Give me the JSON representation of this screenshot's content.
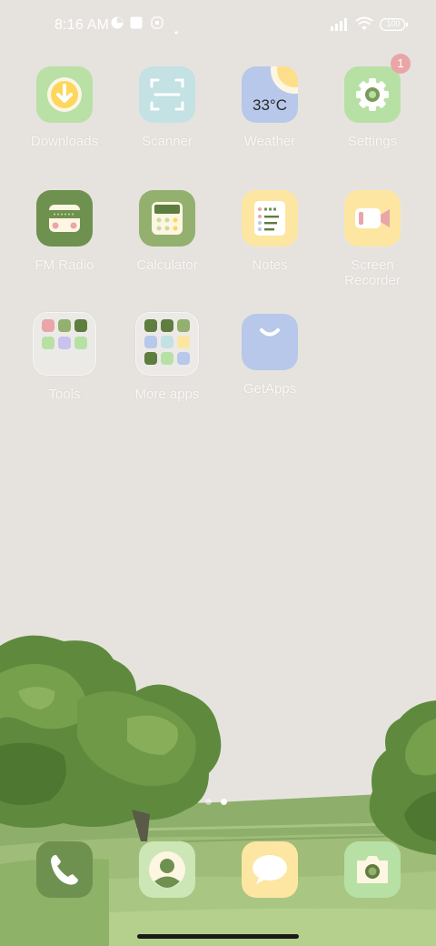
{
  "status_bar": {
    "time": "8:16 AM",
    "battery": "100",
    "icons": [
      "data-saver-icon",
      "square-notification-icon",
      "sim-icon",
      "dot-icon",
      "signal-icon",
      "wifi-icon",
      "battery-icon"
    ]
  },
  "apps": [
    {
      "label": "Downloads",
      "icon": "download-icon",
      "color": "#b9e0a5"
    },
    {
      "label": "Scanner",
      "icon": "scanner-icon",
      "color": "#c4e1e4"
    },
    {
      "label": "Weather",
      "icon": "weather-icon",
      "color": "#b8c8ea",
      "temp": "33°C"
    },
    {
      "label": "Settings",
      "icon": "gear-icon",
      "color": "#b7e0a5",
      "badge": "1"
    },
    {
      "label": "FM Radio",
      "icon": "radio-icon",
      "color": "#6f9150"
    },
    {
      "label": "Calculator",
      "icon": "calculator-icon",
      "color": "#93b06e"
    },
    {
      "label": "Notes",
      "icon": "notes-icon",
      "color": "#fde6a1"
    },
    {
      "label": "Screen Recorder",
      "icon": "video-camera-icon",
      "color": "#fde6a1"
    },
    {
      "label": "Tools",
      "icon": "folder-icon"
    },
    {
      "label": "More apps",
      "icon": "folder-icon"
    },
    {
      "label": "GetApps",
      "icon": "shopping-bag-icon",
      "color": "#b8c8ea"
    }
  ],
  "dock": [
    {
      "name": "phone",
      "icon": "phone-icon",
      "color": "#6f9150"
    },
    {
      "name": "contacts",
      "icon": "contact-icon",
      "color": "#cde6b6"
    },
    {
      "name": "messages",
      "icon": "message-icon",
      "color": "#fde6a1"
    },
    {
      "name": "camera",
      "icon": "camera-icon",
      "color": "#b7e0a5"
    }
  ],
  "page_indicator": {
    "pages": 2,
    "current": 2
  },
  "colors": {
    "background": "#e6e3df",
    "label": "#f7f7f5",
    "green_dark": "#6f9150",
    "badge": "#eaa5a8"
  }
}
